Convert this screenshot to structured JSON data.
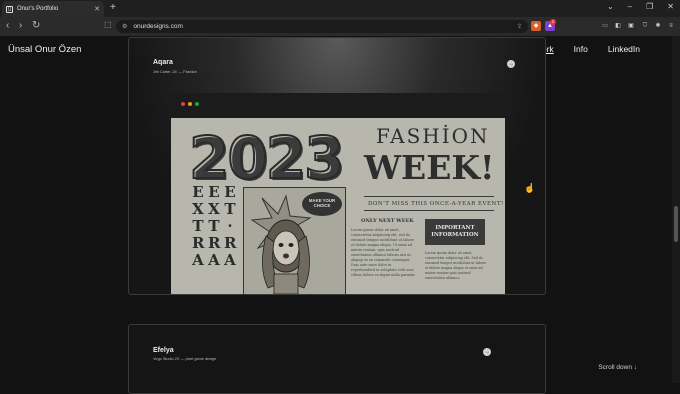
{
  "browser": {
    "tab_title": "Onur's Portfolio",
    "tab_favicon": "[]",
    "new_tab": "+",
    "url": "onurdesigns.com",
    "extension_badge": "2"
  },
  "site": {
    "logo": "Ünsal Onur Özen",
    "nav": [
      "Work",
      "Info",
      "LinkedIn"
    ],
    "projects": [
      {
        "title": "Aqara",
        "subtitle": "Jim Carter, 24'  —  Fashion"
      },
      {
        "title": "Efelya",
        "subtitle": "Virgo Studio 23'  —  pixel game design"
      }
    ],
    "scroll_hint": "Scroll down ↓"
  },
  "poster": {
    "year": "2023",
    "fashion": "FASHİON",
    "week": "WEEK!",
    "dont_miss": "DON'T MISS THIS ONCE-A-YEAR EVENT!",
    "only_next_week": "ONLY NEXT WEEK",
    "bubble": "MAKE YOUR CHOICE",
    "important": "IMPORTANT INFORMATION",
    "body_text": "Lorem ipsum dolor sit amet, consectetur adipiscing elit, sed do eiusmod tempor incididunt ut labore et dolore magna aliqua. Ut enim ad minim veniam, quis nostrud exercitation ullamco laboris nisi ut aliquip ex ea commodo consequat. Duis aute irure dolor in reprehenderit in voluptate velit esse cillum dolore eu fugiat nulla pariatur.",
    "info_text": "Lorem ipsum dolor sit amet, consectetur adipiscing elit. Sed do eiusmod tempor incididunt ut labore et dolore magna aliqua ut enim ad minim veniam quis nostrud exercitation ullamco.",
    "columns": [
      "EXTRA",
      "EXTRA",
      "ET·RA"
    ]
  },
  "colors": {
    "page_bg": "#121212",
    "poster_bg": "#b7b7ad",
    "ink": "#2e2e2e",
    "dot_red": "#e0443e",
    "dot_yellow": "#dea123",
    "dot_green": "#1aab29"
  }
}
